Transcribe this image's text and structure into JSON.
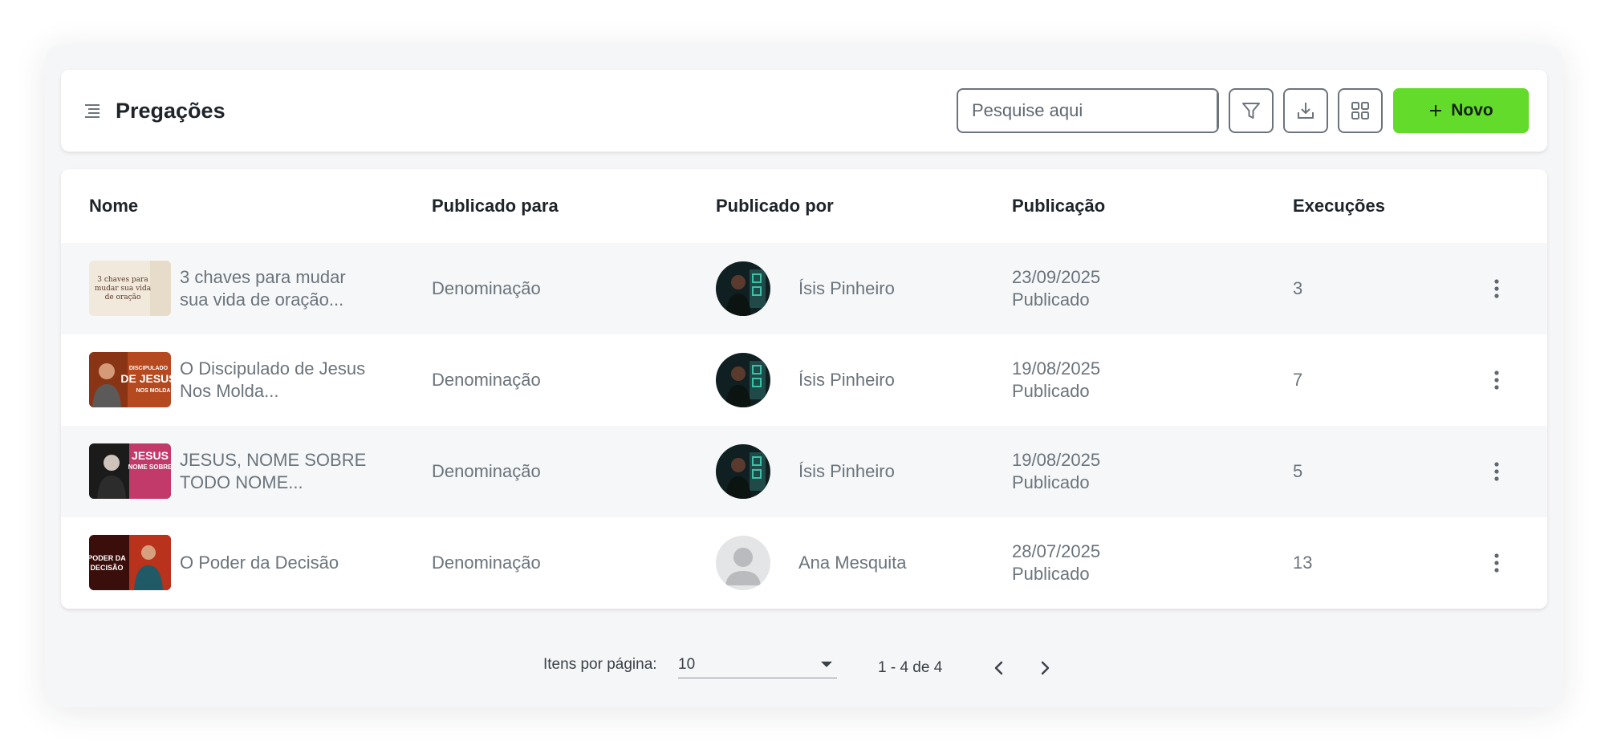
{
  "header": {
    "title": "Pregações",
    "search_placeholder": "Pesquise aqui",
    "new_button_label": "Novo",
    "accent_color": "#63db2a"
  },
  "table": {
    "columns": [
      "Nome",
      "Publicado para",
      "Publicado por",
      "Publicação",
      "Execuções"
    ],
    "rows": [
      {
        "name_line1": "3 chaves para mudar",
        "name_line2": "sua vida de oração...",
        "thumb_text": "3 chaves para mudar sua vida de oração",
        "published_to": "Denominação",
        "published_by": "Ísis Pinheiro",
        "date": "23/09/2025",
        "status": "Publicado",
        "executions": "3"
      },
      {
        "name_line1": "O Discipulado de Jesus",
        "name_line2": "Nos Molda...",
        "thumb_text": "O DISCIPULADO DE JESUS NOS MOLDA",
        "published_to": "Denominação",
        "published_by": "Ísis Pinheiro",
        "date": "19/08/2025",
        "status": "Publicado",
        "executions": "7"
      },
      {
        "name_line1": "JESUS, NOME SOBRE",
        "name_line2": "TODO NOME...",
        "thumb_text": "JESUS NOME SOBRE",
        "published_to": "Denominação",
        "published_by": "Ísis Pinheiro",
        "date": "19/08/2025",
        "status": "Publicado",
        "executions": "5"
      },
      {
        "name_line1": "O Poder da Decisão",
        "name_line2": "",
        "thumb_text": "PODER DA DECISÃO",
        "published_to": "Denominação",
        "published_by": "Ana Mesquita",
        "date": "28/07/2025",
        "status": "Publicado",
        "executions": "13"
      }
    ]
  },
  "pagination": {
    "items_per_page_label": "Itens por página:",
    "items_per_page_value": "10",
    "range_text": "1 - 4 de 4"
  }
}
